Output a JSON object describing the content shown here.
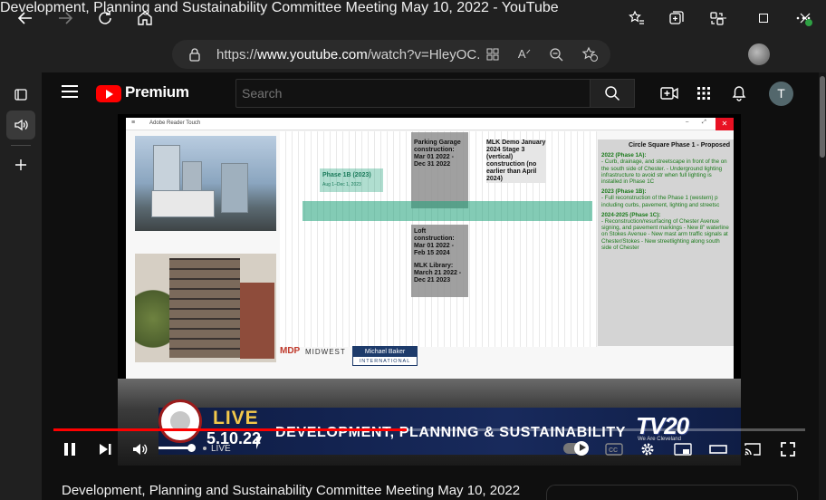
{
  "window": {
    "title": "Development, Planning and Sustainability Committee Meeting May 10, 2022 - YouTube",
    "buttons": {
      "minimize": "—",
      "maximize": "☐",
      "close": "✕"
    }
  },
  "browser": {
    "url_prefix": "https://",
    "url_host": "www.youtube.com",
    "url_path": "/watch?v=HleyOC...",
    "extensions_badge_color": "#2ea043"
  },
  "youtube": {
    "brand": "Premium",
    "search_placeholder": "Search",
    "avatar_letter": "T",
    "accent": "#ff0000"
  },
  "slide": {
    "app_name": "Adobe Reader Touch",
    "phase_1b": "Phase 1B (2023)",
    "phase_1b_dates": "Aug 1–Dec 1, 2023",
    "parking": "Parking Garage construction: Mar 01 2022 - Dec 31 2022",
    "mlk_demo": "MLK Demo January 2024 Stage 3 (vertical) construction (no earlier than April 2024)",
    "loft": "Loft construction: Mar 01 2022 - Feb 15 2024",
    "library": "MLK Library: March 21 2022 - Dec 21 2023",
    "legend_title": "Circle Square Phase 1 - Proposed",
    "legend_1a_head": "2022 (Phase 1A):",
    "legend_1a": "- Curb, drainage, and streetscape in front of the on the south side of Chester. - Underground lighting infrastructure to avoid str when full lighting is installed in Phase 1C",
    "legend_1b_head": "2023 (Phase 1B):",
    "legend_1b": "- Full reconstruction of the Phase 1 (western) p including curbs, pavement, lighting and streetsc",
    "legend_1c_head": "2024-2025 (Phase 1C):",
    "legend_1c": "- Reconstruction/resurfacing of Chester Avenue signing, and pavement markings - New 8\" waterline on Stokes Avenue - New mast arm traffic signals at Chester/Stokes - New streetlighting along south side of Chester",
    "mdp": "MDP",
    "midwest": "MIDWEST",
    "baker_top": "Michael Baker",
    "baker_bottom": "INTERNATIONAL"
  },
  "broadcast": {
    "live": "LIVE",
    "date": "5.10.22",
    "committee": "DEVELOPMENT, PLANNING & SUSTAINABILITY",
    "station": "TV20",
    "tagline": "We Are Cleveland"
  },
  "player": {
    "progress": 0.47,
    "live_label": "LIVE"
  },
  "video_title": "Development, Planning and Sustainability Committee Meeting May 10, 2022"
}
